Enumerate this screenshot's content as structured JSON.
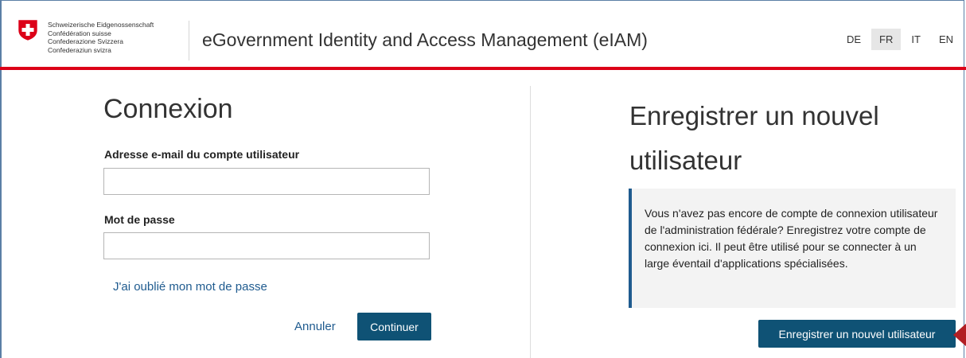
{
  "header": {
    "org_lines": [
      "Schweizerische Eidgenossenschaft",
      "Confédération suisse",
      "Confederazione Svizzera",
      "Confederaziun svizra"
    ],
    "app_title": "eGovernment Identity and Access Management (eIAM)",
    "languages": [
      {
        "code": "DE",
        "active": false
      },
      {
        "code": "FR",
        "active": true
      },
      {
        "code": "IT",
        "active": false
      },
      {
        "code": "EN",
        "active": false
      }
    ]
  },
  "login": {
    "title": "Connexion",
    "email_label": "Adresse e-mail du compte utilisateur",
    "email_value": "",
    "password_label": "Mot de passe",
    "password_value": "",
    "forgot_link": "J'ai oublié mon mot de passe",
    "cancel_label": "Annuler",
    "continue_label": "Continuer"
  },
  "register": {
    "title": "Enregistrer un nouvel utilisateur",
    "info_text": "Vous n'avez pas encore de compte de connexion utilisateur de l'administration fédérale? Enregistrez votre compte de connexion ici. Il peut être utilisé pour se connecter à un large éventail d'applications spécialisées.",
    "button_label": "Enregistrer un nouvel utilisateur"
  },
  "colors": {
    "accent_red": "#dc0018",
    "primary_button": "#0f5275",
    "link": "#1f5b8f",
    "pointer_arrow": "#b21f24"
  }
}
